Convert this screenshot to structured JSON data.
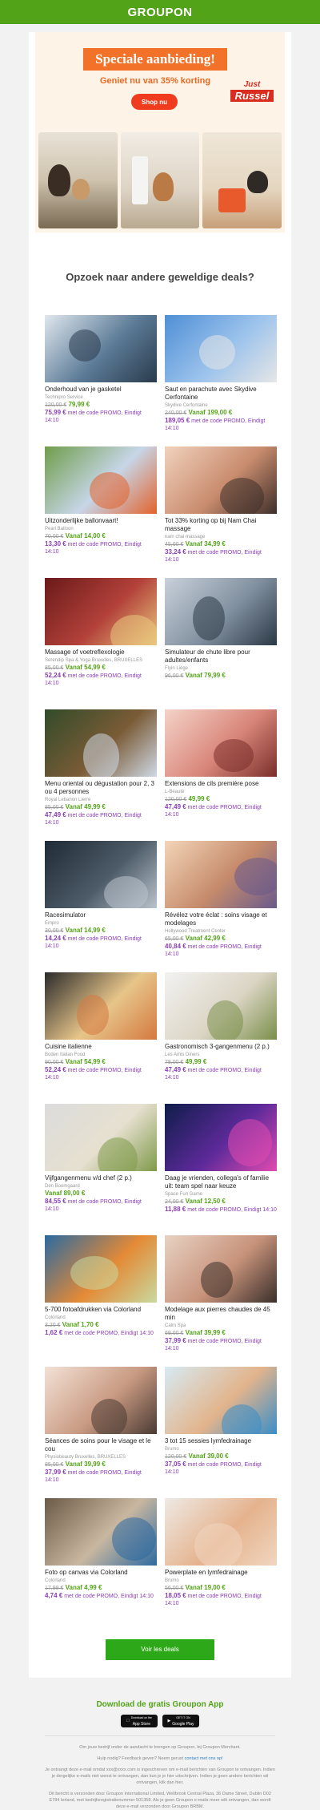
{
  "header": {
    "logo": "GROUPON"
  },
  "hero": {
    "title": "Speciale aanbieding!",
    "subtitle": "Geniet nu van 35% korting",
    "button": "Shop nu",
    "brand_line1": "Just",
    "brand_line2": "Russel"
  },
  "section_title": "Opzoek naar andere geweldige deals?",
  "deals": [
    {
      "title": "Onderhoud van je gasketel",
      "merchant": "Technipro Service",
      "old": "120,00 €",
      "new": "79,99 €",
      "prefix": "",
      "promo_price": "75,99 €",
      "promo_text": "met de code PROMO, Eindigt 14:10"
    },
    {
      "title": "Saut en parachute avec Skydive Cerfontaine",
      "merchant": "Skydive Cerfontaine",
      "old": "240,00 €",
      "new": "199,00 €",
      "prefix": "Vanaf",
      "promo_price": "189,05 €",
      "promo_text": "met de code PROMO, Eindigt 14:10"
    },
    {
      "title": "Uitzonderlijke ballonvaart!",
      "merchant": "Pearl Balloon",
      "old": "70,00 €",
      "new": "14,00 €",
      "prefix": "Vanaf",
      "promo_price": "13,30 €",
      "promo_text": "met de code PROMO, Eindigt 14:10"
    },
    {
      "title": "Tot 33% korting op bij Nam Chai massage",
      "merchant": "nam chai massage",
      "old": "45,00 €",
      "new": "34,99 €",
      "prefix": "Vanaf",
      "promo_price": "33,24 €",
      "promo_text": "met de code PROMO, Eindigt 14:10"
    },
    {
      "title": "Massage of voetreflexologie",
      "merchant": "Serendip Spa & Yoga Bruxelles, BRUXELLES",
      "old": "85,00 €",
      "new": "54,99 €",
      "prefix": "Vanaf",
      "promo_price": "52,24 €",
      "promo_text": "met de code PROMO, Eindigt 14:10"
    },
    {
      "title": "Simulateur de chute libre pour adultes/enfants",
      "merchant": "Flyin Liège",
      "old": "96,00 €",
      "new": "79,99 €",
      "prefix": "Vanaf",
      "promo_price": "",
      "promo_text": ""
    },
    {
      "title": "Menu oriental ou dégustation pour 2, 3 ou 4 personnes",
      "merchant": "Royal Lebanon Lierre",
      "old": "85,00 €",
      "new": "49,99 €",
      "prefix": "Vanaf",
      "promo_price": "47,49 €",
      "promo_text": "met de code PROMO, Eindigt 14:10"
    },
    {
      "title": "Extensions de cils première pose",
      "merchant": "L-Beauté",
      "old": "120,00 €",
      "new": "49,99 €",
      "prefix": "",
      "promo_price": "47,49 €",
      "promo_text": "met de code PROMO, Eindigt 14:10"
    },
    {
      "title": "Racesimulator",
      "merchant": "Empro",
      "old": "30,00 €",
      "new": "14,99 €",
      "prefix": "Vanaf",
      "promo_price": "14,24 €",
      "promo_text": "met de code PROMO, Eindigt 14:10"
    },
    {
      "title": "Révélez votre éclat : soins visage et modelages",
      "merchant": "Hollywood Treatment Center",
      "old": "65,00 €",
      "new": "42,99 €",
      "prefix": "Vanaf",
      "promo_price": "40,84 €",
      "promo_text": "met de code PROMO, Eindigt 14:10"
    },
    {
      "title": "Cuisine italienne",
      "merchant": "Boden Italian Food",
      "old": "90,00 €",
      "new": "54,99 €",
      "prefix": "Vanaf",
      "promo_price": "52,24 €",
      "promo_text": "met de code PROMO, Eindigt 14:10"
    },
    {
      "title": "Gastronomisch 3-gangenmenu (2 p.)",
      "merchant": "Les Amis Diners",
      "old": "78,00 €",
      "new": "49,99 €",
      "prefix": "",
      "promo_price": "47,49 €",
      "promo_text": "met de code PROMO, Eindigt 14:10"
    },
    {
      "title": "Vijfgangenmenu v/d chef (2 p.)",
      "merchant": "Den Boomgaard",
      "old": "",
      "new": "89,00 €",
      "prefix": "Vanaf",
      "promo_price": "84,55 €",
      "promo_text": "met de code PROMO, Eindigt 14:10"
    },
    {
      "title": "Daag je vrienden, collega's of familie uit: team spel naar keuze",
      "merchant": "Space Fun Game",
      "old": "24,00 €",
      "new": "12,50 €",
      "prefix": "Vanaf",
      "promo_price": "11,88 €",
      "promo_text": "met de code PROMO, Eindigt 14:10"
    },
    {
      "title": "5-700 fotoafdrukken via Colorland",
      "merchant": "Colorland",
      "old": "3,20 €",
      "new": "1,70 €",
      "prefix": "Vanaf",
      "promo_price": "1,62 €",
      "promo_text": "met de code PROMO, Eindigt 14:10"
    },
    {
      "title": "Modelage aux pierres chaudes de 45 min",
      "merchant": "Calm Spa",
      "old": "69,00 €",
      "new": "39,99 €",
      "prefix": "Vanaf",
      "promo_price": "37,99 €",
      "promo_text": "met de code PROMO, Eindigt 14:10"
    },
    {
      "title": "Séances de soins pour le visage et le cou",
      "merchant": "Physiobeauty Bruxelles, BRUXELLES",
      "old": "85,00 €",
      "new": "39,99 €",
      "prefix": "Vanaf",
      "promo_price": "37,99 €",
      "promo_text": "met de code PROMO, Eindigt 14:10"
    },
    {
      "title": "3 tot 15 sessies lymfedrainage",
      "merchant": "Brumo",
      "old": "120,00 €",
      "new": "39,00 €",
      "prefix": "Vanaf",
      "promo_price": "37,05 €",
      "promo_text": "met de code PROMO, Eindigt 14:10"
    },
    {
      "title": "Foto op canvas via Colorland",
      "merchant": "Colorland",
      "old": "17,99 €",
      "new": "4,99 €",
      "prefix": "Vanaf",
      "promo_price": "4,74 €",
      "promo_text": "met de code PROMO, Eindigt 14:10"
    },
    {
      "title": "Powerplate en lymfedrainage",
      "merchant": "Brumo",
      "old": "56,00 €",
      "new": "19,00 €",
      "prefix": "Vanaf",
      "promo_price": "18,05 €",
      "promo_text": "met de code PROMO, Eindigt 14:10"
    }
  ],
  "cta": "Voir les deals",
  "app": {
    "title": "Download de gratis Groupon App",
    "appstore_small": "Download on the",
    "appstore": "App Store",
    "play_small": "GET IT ON",
    "play": "Google Play"
  },
  "footer": {
    "line1": "Om jouw bedrijf onder de aandacht te brengen op Groupon, bij Groupon Merchant.",
    "line2_a": "Hulp nodig? Feedback geven? Neem gerust ",
    "line2_link": "contact met ons op!",
    "line3": "Je ontvangt deze e-mail omdat xxx@xxxx.com is ingeschreven om e-mail berichten van Groupon te ontvangen. Indien je dergelijke e-mails niet wenst te ontvangen, dan kun je je hier uitschrijven. Indien je geen andere berichten wil ontvangen, klik dan hier.",
    "line4": "Dit bericht is verzonden door Groupon International Limited, Wellbrook Central Plaza, 36 Dame Street, Dublin D02 E784 Ierland, met bedrijfsregistratienummer 501358. Als je geen Groupon e-mails meer wilt ontvangen, dan wordt deze e-mail verzonden door Groupon BRBM."
  },
  "colors": {
    "brand": "#53a318",
    "promo": "#8b3eb5",
    "cta": "#2da818",
    "hero_accent": "#f3722a"
  }
}
